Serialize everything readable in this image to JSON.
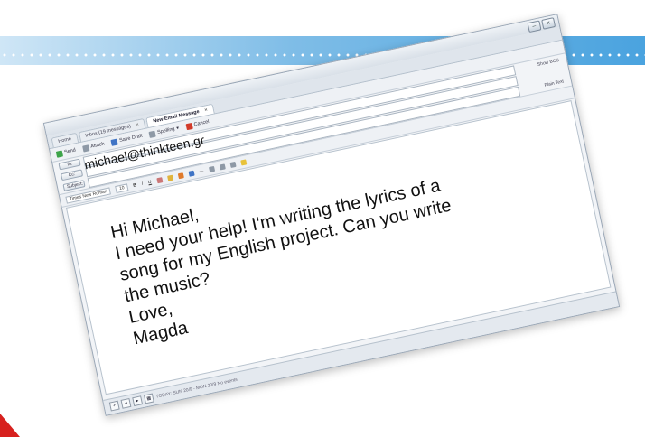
{
  "window": {
    "tabs": [
      {
        "label": "Home"
      },
      {
        "label": "Inbox (19 messages)"
      },
      {
        "label": "New Email Message"
      }
    ],
    "toolbar": {
      "send": "Send",
      "attach": "Attach",
      "save_draft": "Save Draft",
      "spelling": "Spelling",
      "cancel": "Cancel"
    },
    "fields": {
      "to_label": "To:",
      "to_value": "michael@thinkteen.gr",
      "cc_label": "Cc:",
      "subject_label": "Subject:",
      "show_bcc": "Show BCC",
      "plain_text": "Plain Text"
    },
    "format": {
      "font": "Times New Roman",
      "size": "10"
    },
    "message_lines": [
      "Hi Michael,",
      "I need your help! I'm writing the lyrics of a",
      "song for my English project. Can you write",
      "the music?",
      "Love,",
      "Magda"
    ],
    "status": "TODAY: SUN 20/9 - MON 20/9 No events"
  }
}
